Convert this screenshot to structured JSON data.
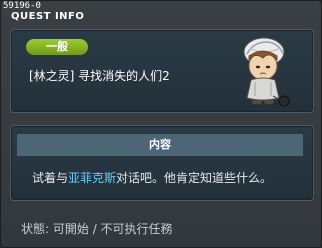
{
  "window": {
    "quest_id": "59196-0",
    "title": "QUEST INFO"
  },
  "quest": {
    "category": "一般",
    "title": "[林之灵] 寻找消失的人们2"
  },
  "content": {
    "header": "内容",
    "text_before": "试着与",
    "npc_name": "亚菲克斯",
    "text_after": "对话吧。他肯定知道些什么。"
  },
  "status": {
    "label": "状態:",
    "value": "可開始 / 不可执行任務"
  },
  "colors": {
    "category_badge": "#8cbf1e",
    "npc_highlight": "#5fd3ff",
    "panel_bg": "#263540",
    "header_bar": "#4c6675"
  },
  "icons": {
    "portrait": "npc-portrait-icon"
  }
}
